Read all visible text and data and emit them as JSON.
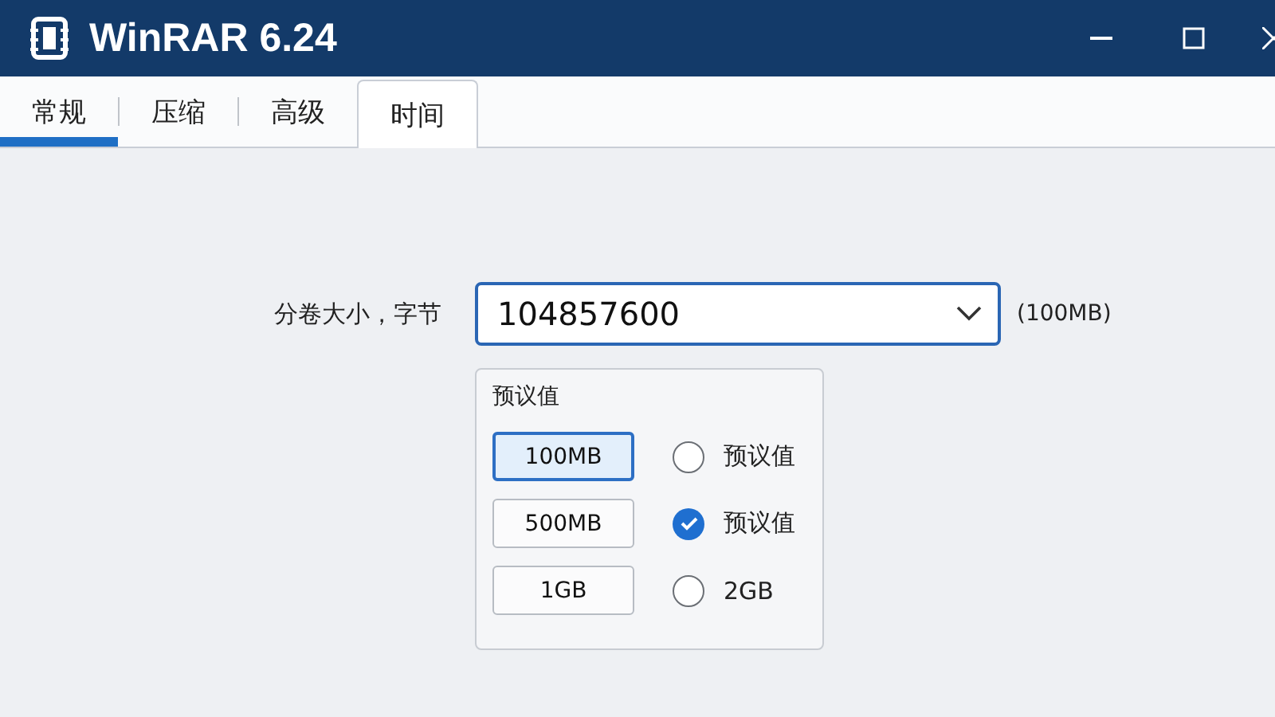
{
  "window": {
    "title": "WinRAR 6.24"
  },
  "tabs": [
    {
      "label": "常规",
      "selected": true,
      "outlined": false
    },
    {
      "label": "压缩",
      "selected": false,
      "outlined": false
    },
    {
      "label": "高级",
      "selected": false,
      "outlined": false
    },
    {
      "label": "时间",
      "selected": false,
      "outlined": true
    }
  ],
  "volume_size": {
    "label": "分卷大小，字节",
    "value": "104857600",
    "note": "(100MB)"
  },
  "presets": {
    "title": "预议值",
    "rows": [
      {
        "button": {
          "label": "100MB",
          "selected": true
        },
        "radio": {
          "label": "预议值",
          "checked": false
        }
      },
      {
        "button": {
          "label": "500MB",
          "selected": false
        },
        "radio": {
          "label": "预议值",
          "checked": true
        }
      },
      {
        "button": {
          "label": "1GB",
          "selected": false
        },
        "radio": {
          "label": "2GB",
          "checked": false
        }
      }
    ]
  }
}
